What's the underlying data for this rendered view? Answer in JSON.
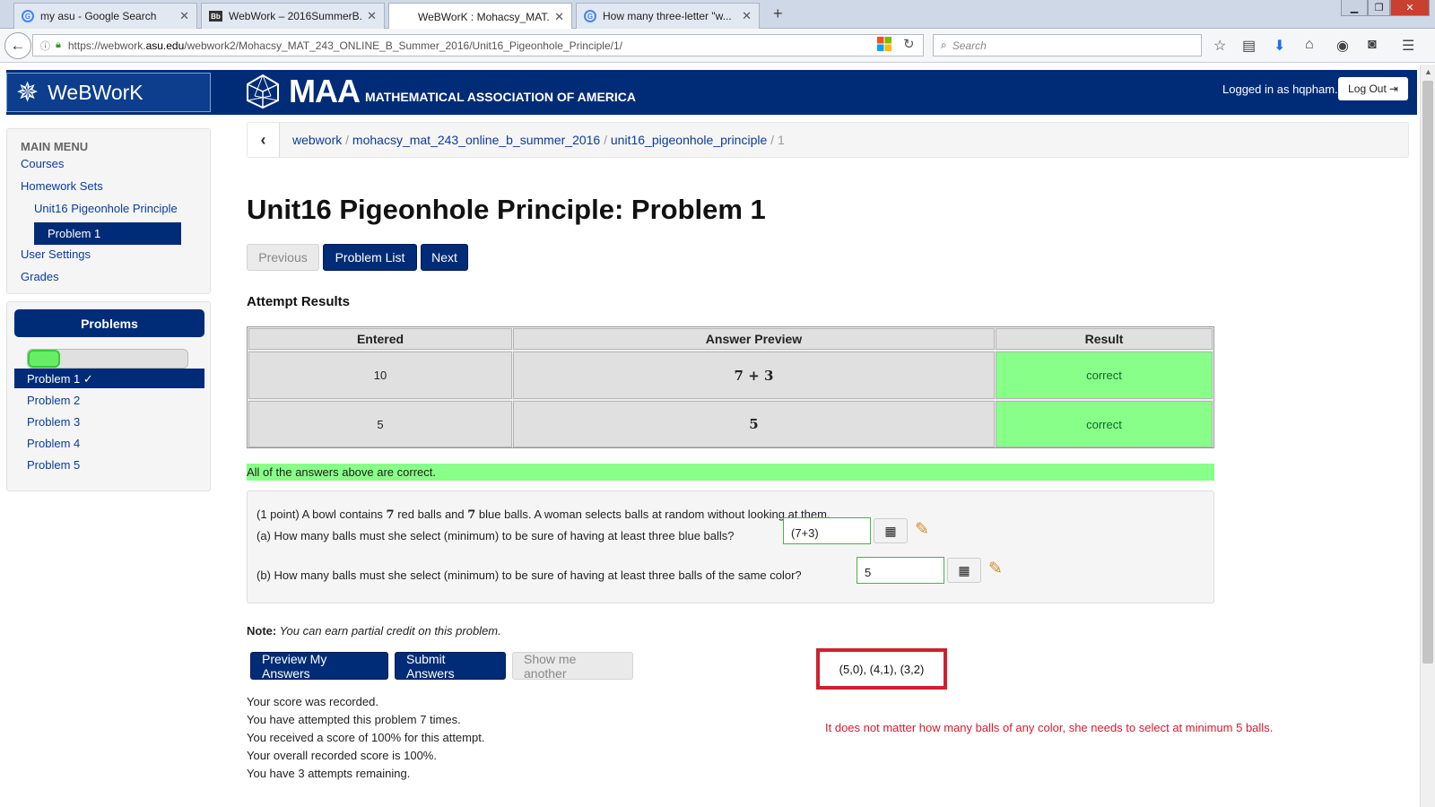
{
  "browser": {
    "tabs": [
      {
        "title": "my asu - Google Search",
        "icon": "google-icon"
      },
      {
        "title": "WebWork – 2016SummerB...",
        "icon": "blackboard-icon"
      },
      {
        "title": "WeBWorK : Mohacsy_MAT...",
        "icon": "none"
      },
      {
        "title": "How many three-letter \"w...",
        "icon": "google-icon"
      }
    ],
    "url_prefix": "https://webwork.",
    "url_host": "asu.edu",
    "url_path": "/webwork2/Mohacsy_MAT_243_ONLINE_B_Summer_2016/Unit16_Pigeonhole_Principle/1/",
    "search_placeholder": "Search"
  },
  "header": {
    "logo_text": "WeBWorK",
    "maa_big": "MAA",
    "maa_small": "MATHEMATICAL ASSOCIATION OF AMERICA",
    "logged_in": "Logged in as hqpham.",
    "logout": "Log Out"
  },
  "sidebar": {
    "heading": "MAIN MENU",
    "courses": "Courses",
    "homework_sets": "Homework Sets",
    "set_name": "Unit16 Pigeonhole Principle",
    "current_problem": "Problem 1",
    "user_settings": "User Settings",
    "grades": "Grades",
    "problems_label": "Problems",
    "progress_fraction": 0.2,
    "problem_items": [
      "Problem 1 ✓",
      "Problem 2",
      "Problem 3",
      "Problem 4",
      "Problem 5"
    ]
  },
  "breadcrumb": {
    "items": [
      "webwork",
      "mohacsy_mat_243_online_b_summer_2016",
      "unit16_pigeonhole_principle"
    ],
    "current": "1",
    "sep": "/"
  },
  "main": {
    "title": "Unit16 Pigeonhole Principle: Problem 1",
    "prev": "Previous",
    "problem_list": "Problem List",
    "next": "Next",
    "attempt_title": "Attempt Results",
    "columns": [
      "Entered",
      "Answer Preview",
      "Result"
    ],
    "rows": [
      {
        "entered": "10",
        "preview": "7 + 3",
        "result": "correct"
      },
      {
        "entered": "5",
        "preview": "5",
        "result": "correct"
      }
    ],
    "all_correct": "All of the answers above are correct.",
    "problem_intro_1": "(1 point) A bowl contains ",
    "problem_red_count": "7",
    "problem_intro_2": " red balls and ",
    "problem_blue_count": "7",
    "problem_intro_3": " blue balls. A woman selects balls at random without looking at them.",
    "part_a": "(a) How many balls must she select (minimum) to be sure of having at least three blue balls?",
    "answer_a": "(7+3)",
    "part_b": "(b) How many balls must she select (minimum) to be sure of having at least three balls of the same color?",
    "answer_b": "5",
    "note_label": "Note:",
    "note_text": " You can earn partial credit on this problem.",
    "preview_btn": "Preview My Answers",
    "submit_btn": "Submit Answers",
    "show_another": "Show me another",
    "score_lines": [
      "Your score was recorded.",
      "You have attempted this problem 7 times.",
      "You received a score of 100% for this attempt.",
      "Your overall recorded score is 100%.",
      "You have 3 attempts remaining."
    ]
  },
  "annotation": {
    "box_text": "(5,0), (4,1), (3,2)",
    "note": "It does not matter how many balls of any color, she needs to select at minimum 5 balls."
  },
  "colors": {
    "brand": "#002c77",
    "correct": "#88ff88",
    "annotation": "#d0202c"
  }
}
